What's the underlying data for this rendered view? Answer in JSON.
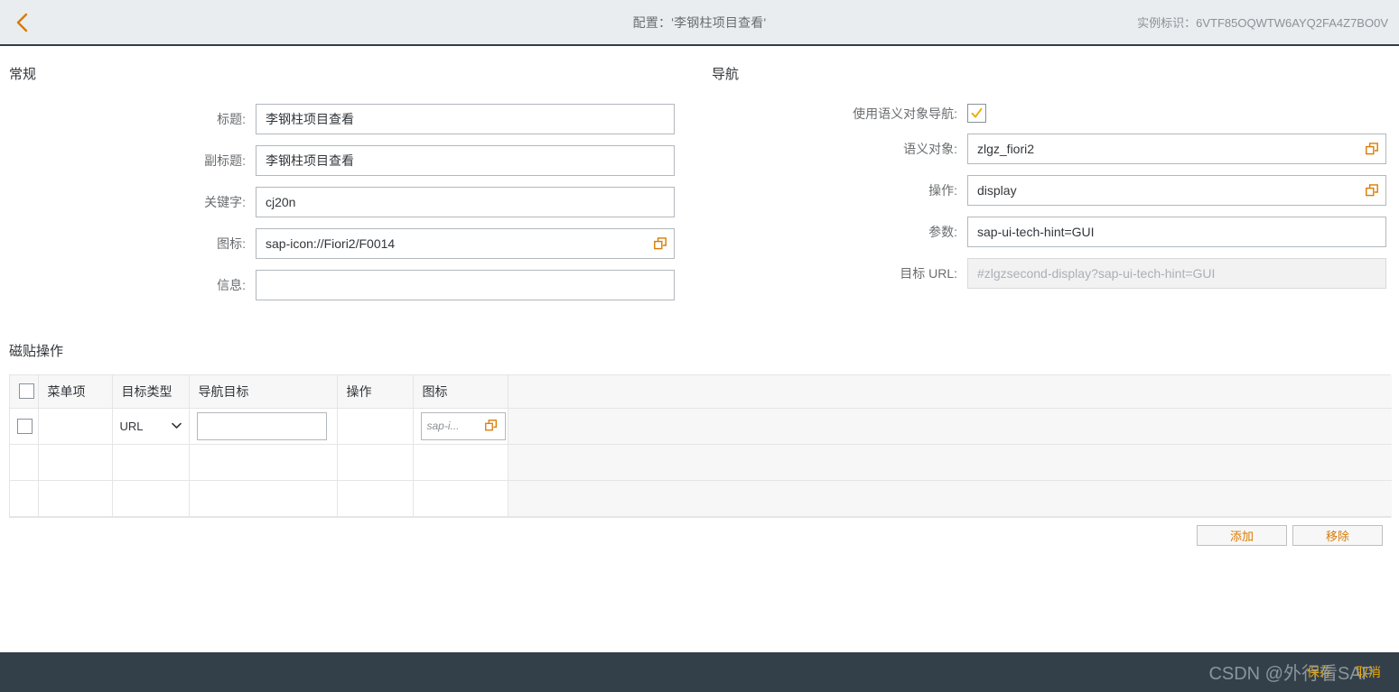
{
  "header": {
    "back_icon": "chevron-left-icon",
    "title": "配置：'李钢柱项目查看'",
    "instance": "实例标识：6VTF85OQWTW6AYQ2FA4Z7BO0V"
  },
  "general": {
    "section_title": "常规",
    "fields": [
      {
        "label": "标题:",
        "value": "李钢柱项目查看",
        "placeholder": "",
        "readonly": false,
        "value_help": false
      },
      {
        "label": "副标题:",
        "value": "李钢柱项目查看",
        "placeholder": "",
        "readonly": false,
        "value_help": false
      },
      {
        "label": "关键字:",
        "value": "cj20n",
        "placeholder": "",
        "readonly": false,
        "value_help": false
      },
      {
        "label": "图标:",
        "value": "sap-icon://Fiori2/F0014",
        "placeholder": "",
        "readonly": false,
        "value_help": true
      },
      {
        "label": "信息:",
        "value": "",
        "placeholder": "",
        "readonly": false,
        "value_help": false
      }
    ]
  },
  "navigation": {
    "section_title": "导航",
    "checkbox": {
      "label": "使用语义对象导航:",
      "checked": true,
      "icon": "check-icon"
    },
    "fields": [
      {
        "label": "语义对象:",
        "value": "zlgz_fiori2",
        "placeholder": "",
        "readonly": false,
        "value_help": true
      },
      {
        "label": "操作:",
        "value": "display",
        "placeholder": "",
        "readonly": false,
        "value_help": true
      },
      {
        "label": "参数:",
        "value": "sap-ui-tech-hint=GUI",
        "placeholder": "",
        "readonly": false,
        "value_help": false
      },
      {
        "label": "目标 URL:",
        "value": "",
        "placeholder": "#zlgzsecond-display?sap-ui-tech-hint=GUI",
        "readonly": true,
        "value_help": false
      }
    ]
  },
  "tile_actions": {
    "section_title": "磁贴操作",
    "columns": [
      "",
      "菜单项",
      "目标类型",
      "导航目标",
      "操作",
      "图标",
      ""
    ],
    "rows": [
      {
        "selected": false,
        "menu_item": "",
        "target_type": "URL",
        "target_type_options": [
          "URL"
        ],
        "nav_target": "",
        "action": "",
        "icon_value": "",
        "icon_placeholder": "sap-i..."
      },
      {
        "empty": true
      },
      {
        "empty": true
      }
    ],
    "buttons": {
      "add": "添加",
      "remove": "移除"
    }
  },
  "footer": {
    "save": "保存",
    "cancel": "取消",
    "watermark": "CSDN @外行看SAP"
  },
  "colors": {
    "accent": "#d97b00",
    "header_bg": "#eaedef",
    "header_border": "#2c3e50",
    "footer_bg": "#344049",
    "footer_action": "#f0ab00"
  }
}
